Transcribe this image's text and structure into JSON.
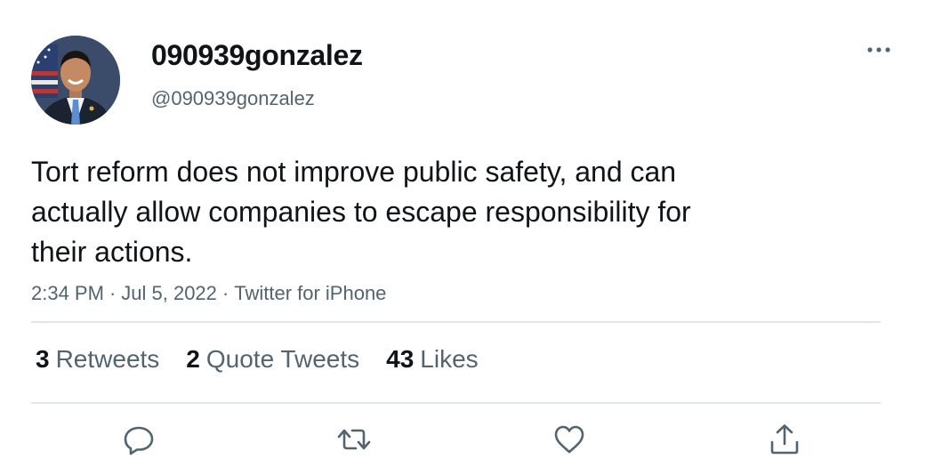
{
  "user": {
    "display_name": "090939gonzalez",
    "handle": "@090939gonzalez"
  },
  "tweet": {
    "text_lines": [
      "Tort reform does not improve public safety, and can",
      "actually allow companies to escape responsibility for",
      "their actions."
    ],
    "time": "2:34 PM",
    "date": "Jul 5, 2022",
    "source": "Twitter for iPhone",
    "separator": "·"
  },
  "stats": {
    "retweets": {
      "count": "3",
      "label": "Retweets"
    },
    "quote_tweets": {
      "count": "2",
      "label": "Quote Tweets"
    },
    "likes": {
      "count": "43",
      "label": "Likes"
    }
  },
  "actions": {
    "icons": [
      "reply-icon",
      "retweet-icon",
      "like-icon",
      "share-icon"
    ]
  },
  "colors": {
    "text_primary": "#0f1419",
    "text_secondary": "#536471",
    "divider": "#e1e6ea"
  }
}
